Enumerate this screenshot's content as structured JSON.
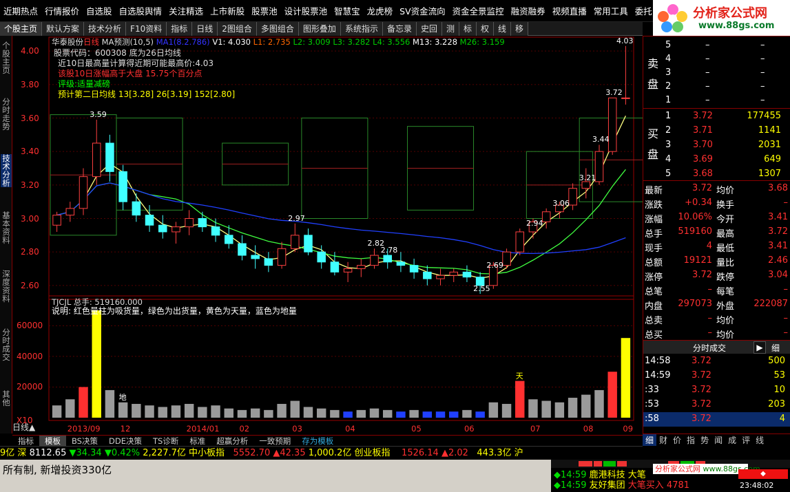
{
  "top_menu": [
    "近期热点",
    "行情报价",
    "自选股",
    "自选股舆情",
    "关注精选",
    "上市新股",
    "股票池",
    "设计股票池",
    "智慧宝",
    "龙虎榜",
    "SV资金流向",
    "资金全景监控",
    "融资融券",
    "视频直播",
    "常用工具",
    "委托"
  ],
  "logo": {
    "brand": "分析家公式网",
    "url": "www.88gs.com"
  },
  "toolbar": [
    "个股主页",
    "默认方案",
    "技术分析",
    "F10资料",
    "指标",
    "日线",
    "2图组合",
    "多图组合",
    "图形叠加",
    "系统指示",
    "备忘录",
    "史回",
    "测",
    "标",
    "权",
    "线",
    "移"
  ],
  "left_tabs": [
    "个股主页",
    "分时走势",
    "技术分析",
    "基本资料",
    "深度资料",
    "分时成交",
    "其他"
  ],
  "header": {
    "stock_name": "华泰股份",
    "period": "日线",
    "indicator": "MA预测(10,5)",
    "ma_tag": "MA1(8.2.786)",
    "v1": "V1: 4.030",
    "l1": "L1: 2.735",
    "l2": "L2: 3.009",
    "l3": "L3: 3.282",
    "l4": "L4: 3.556",
    "m13": "M13: 3.228",
    "m26": "M26: 3.159"
  },
  "info_box": {
    "line1": "股票代码：600308 底为26日均线",
    "line2": "近10日最高量计算得近期可能最高价:4.03",
    "line3": "该股10日涨幅高于大盘 15.75个百分点",
    "line4": "评级:适量减磅",
    "line5": "预计第二日均线 13[3.28] 26[3.19] 152[2.80]"
  },
  "price_axis": [
    "4.00",
    "3.80",
    "3.60",
    "3.40",
    "3.20",
    "3.00",
    "2.80",
    "2.60"
  ],
  "annotations": [
    "4.03",
    "3.72",
    "3.59",
    "3.44",
    "3.21",
    "3.06",
    "2.97",
    "2.94",
    "2.82",
    "2.78",
    "2.69",
    "2.55"
  ],
  "vol_header": {
    "title": "TJCJL 总手: 519160.000",
    "desc": "说明: 红色量柱为吸货量，绿色为出货量，黄色为天量，蓝色为地量"
  },
  "vol_axis": [
    "60000",
    "40000",
    "20000",
    "X10"
  ],
  "vol_marks": [
    "地",
    "天"
  ],
  "date_axis": [
    "2013/09",
    "12",
    "2014/01",
    "02",
    "03",
    "04",
    "05",
    "06",
    "07",
    "08",
    "09"
  ],
  "bottom_tabs": [
    "指标",
    "模板",
    "BS决策",
    "DDE决策",
    "TS诊断",
    "标准",
    "超赢分析",
    "一致预期",
    "存为模板"
  ],
  "ticker": {
    "p1": "9亿",
    "p2": "深",
    "p3": "8112.65",
    "p4": "▼34.34",
    "p5": "▼0.42%",
    "p6": "2,227.7亿",
    "p7": "中小板指",
    "p8": "5552.70",
    "p9": "▲42.35",
    "p10": "1,000.2亿",
    "p11": "创业板指",
    "p12": "1526.14",
    "p13": "▲2.02",
    "p14": "443.3亿",
    "p15": "沪"
  },
  "status_text": "所有制, 新增投资330亿",
  "news": [
    {
      "time": "◆14:59",
      "stock": "鹿港科技",
      "event": "大笔"
    },
    {
      "time": "◆14:59",
      "stock": "友好集团",
      "event": "大笔买入",
      "vol": "4781"
    }
  ],
  "clock": "23:48:02",
  "orderbook": {
    "sell_label": "卖盘",
    "buy_label": "买盘",
    "sells": [
      {
        "lvl": "5",
        "p": "–",
        "v": "–"
      },
      {
        "lvl": "4",
        "p": "–",
        "v": "–"
      },
      {
        "lvl": "3",
        "p": "–",
        "v": "–"
      },
      {
        "lvl": "2",
        "p": "–",
        "v": "–"
      },
      {
        "lvl": "1",
        "p": "–",
        "v": "–"
      }
    ],
    "buys": [
      {
        "lvl": "1",
        "p": "3.72",
        "v": "177455"
      },
      {
        "lvl": "2",
        "p": "3.71",
        "v": "1141"
      },
      {
        "lvl": "3",
        "p": "3.70",
        "v": "2031"
      },
      {
        "lvl": "4",
        "p": "3.69",
        "v": "649"
      },
      {
        "lvl": "5",
        "p": "3.68",
        "v": "1307"
      }
    ]
  },
  "quote": [
    {
      "l": "最新",
      "v": "3.72",
      "l2": "均价",
      "v2": "3.68"
    },
    {
      "l": "涨跌",
      "v": "+0.34",
      "l2": "换手",
      "v2": "–"
    },
    {
      "l": "涨幅",
      "v": "10.06%",
      "l2": "今开",
      "v2": "3.41"
    },
    {
      "l": "总手",
      "v": "519160",
      "l2": "最高",
      "v2": "3.72"
    },
    {
      "l": "现手",
      "v": "4",
      "l2": "最低",
      "v2": "3.41"
    },
    {
      "l": "总额",
      "v": "19121",
      "l2": "量比",
      "v2": "2.46"
    },
    {
      "l": "涨停",
      "v": "3.72",
      "l2": "跌停",
      "v2": "3.04"
    },
    {
      "l": "总笔",
      "v": "–",
      "l2": "每笔",
      "v2": "–"
    },
    {
      "l": "内盘",
      "v": "297073",
      "l2": "外盘",
      "v2": "222087"
    },
    {
      "l": "总卖",
      "v": "–",
      "l2": "均价",
      "v2": "–"
    },
    {
      "l": "总买",
      "v": "–",
      "l2": "均价",
      "v2": "–"
    }
  ],
  "ticks_title": "分时成交",
  "ticks": [
    {
      "t": "14:58",
      "p": "3.72",
      "v": "500"
    },
    {
      "t": "14:59",
      "p": "3.72",
      "v": "53"
    },
    {
      "t": ":33",
      "p": "3.72",
      "v": "10"
    },
    {
      "t": ":53",
      "p": "3.72",
      "v": "203"
    },
    {
      "t": ":58",
      "p": "3.72",
      "v": "4"
    }
  ],
  "right_tabs": [
    "细",
    "财",
    "价",
    "指",
    "势",
    "闻",
    "成",
    "评",
    "线"
  ],
  "chart_data": {
    "type": "candlestick",
    "title": "华泰股份 日线",
    "ylim": [
      2.55,
      4.05
    ],
    "candles": [
      [
        2.96,
        3.04,
        2.92,
        3.02
      ],
      [
        3.02,
        3.1,
        2.98,
        3.06
      ],
      [
        3.06,
        3.3,
        3.02,
        3.25
      ],
      [
        3.25,
        3.59,
        3.2,
        3.45
      ],
      [
        3.45,
        3.5,
        3.22,
        3.28
      ],
      [
        3.28,
        3.32,
        3.05,
        3.1
      ],
      [
        3.1,
        3.15,
        2.98,
        3.02
      ],
      [
        3.02,
        3.08,
        2.92,
        2.96
      ],
      [
        2.96,
        3.02,
        2.88,
        2.92
      ],
      [
        2.92,
        2.98,
        2.85,
        2.95
      ],
      [
        2.95,
        3.05,
        2.9,
        3.0
      ],
      [
        3.0,
        3.04,
        2.92,
        2.95
      ],
      [
        2.95,
        3.0,
        2.86,
        2.9
      ],
      [
        2.9,
        2.96,
        2.82,
        2.85
      ],
      [
        2.85,
        2.9,
        2.75,
        2.78
      ],
      [
        2.78,
        2.84,
        2.7,
        2.76
      ],
      [
        2.76,
        2.8,
        2.68,
        2.72
      ],
      [
        2.72,
        2.86,
        2.7,
        2.82
      ],
      [
        2.82,
        2.97,
        2.8,
        2.9
      ],
      [
        2.9,
        2.94,
        2.78,
        2.8
      ],
      [
        2.8,
        2.84,
        2.7,
        2.74
      ],
      [
        2.74,
        2.8,
        2.66,
        2.68
      ],
      [
        2.68,
        2.74,
        2.62,
        2.7
      ],
      [
        2.7,
        2.76,
        2.65,
        2.72
      ],
      [
        2.72,
        2.82,
        2.7,
        2.78
      ],
      [
        2.78,
        2.82,
        2.7,
        2.74
      ],
      [
        2.74,
        2.8,
        2.68,
        2.72
      ],
      [
        2.72,
        2.76,
        2.64,
        2.68
      ],
      [
        2.68,
        2.72,
        2.6,
        2.64
      ],
      [
        2.64,
        2.7,
        2.6,
        2.66
      ],
      [
        2.66,
        2.7,
        2.62,
        2.68
      ],
      [
        2.68,
        2.72,
        2.62,
        2.65
      ],
      [
        2.65,
        2.68,
        2.55,
        2.6
      ],
      [
        2.6,
        2.74,
        2.58,
        2.72
      ],
      [
        2.72,
        2.82,
        2.7,
        2.8
      ],
      [
        2.8,
        2.94,
        2.78,
        2.92
      ],
      [
        2.92,
        3.0,
        2.88,
        2.98
      ],
      [
        2.98,
        3.06,
        2.94,
        3.04
      ],
      [
        3.04,
        3.1,
        3.0,
        3.08
      ],
      [
        3.08,
        3.21,
        3.05,
        3.18
      ],
      [
        3.18,
        3.3,
        3.12,
        3.22
      ],
      [
        3.22,
        3.44,
        3.2,
        3.4
      ],
      [
        3.4,
        3.72,
        3.38,
        3.72
      ],
      [
        3.72,
        4.03,
        3.68,
        3.72
      ]
    ],
    "volumes": [
      8,
      12,
      20,
      70,
      18,
      10,
      9,
      8,
      7,
      8,
      9,
      7,
      8,
      6,
      5,
      6,
      5,
      9,
      11,
      7,
      6,
      5,
      4,
      5,
      6,
      5,
      4,
      5,
      4,
      4,
      4,
      5,
      4,
      10,
      9,
      24,
      12,
      11,
      10,
      13,
      15,
      18,
      30,
      52
    ],
    "ma_lines": [
      "MA13",
      "MA26",
      "MA152"
    ]
  }
}
